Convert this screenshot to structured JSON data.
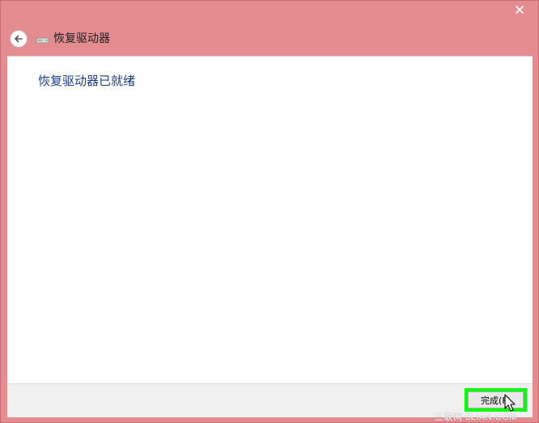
{
  "window": {
    "title": "恢复驱动器",
    "close_icon": "close-icon",
    "back_icon": "back-arrow-icon",
    "drive_icon": "drive-icon",
    "frame_color": "#e48c8f"
  },
  "content": {
    "heading": "恢复驱动器已就绪",
    "heading_color": "#1a3f8a"
  },
  "footer": {
    "finish_label": "完成(F)",
    "highlight_color": "#00ff00"
  },
  "watermark": {
    "text": "三联网 3LIAN.COM"
  }
}
